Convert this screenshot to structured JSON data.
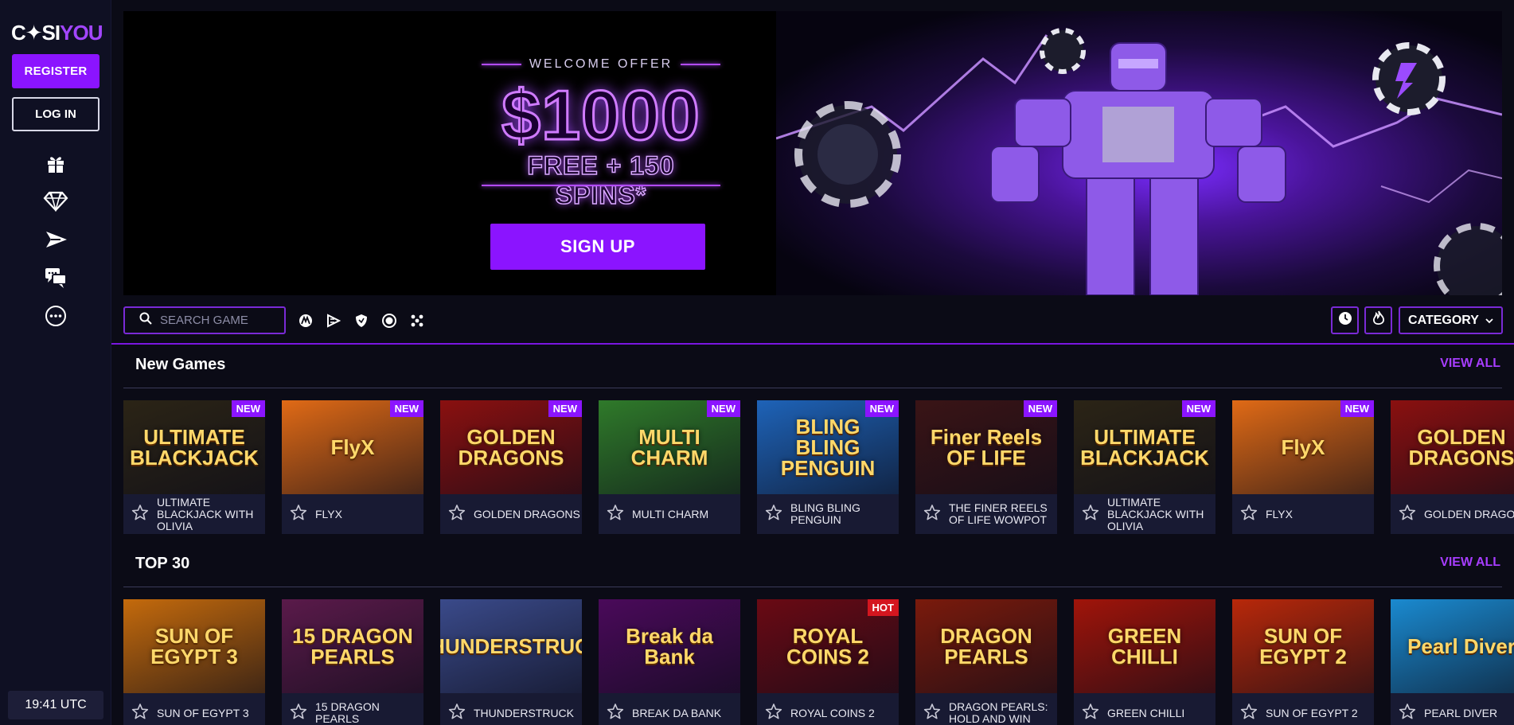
{
  "sidebar": {
    "logo_left": "C✦SI",
    "logo_right": "YOU",
    "register_label": "REGISTER",
    "login_label": "LOG IN",
    "icons": [
      "gift-icon",
      "diamond-icon",
      "sports-icon",
      "chat-icon",
      "more-icon"
    ],
    "clock": "19:41 UTC"
  },
  "banner": {
    "welcome": "WELCOME OFFER",
    "amount": "$1000",
    "sub": "FREE + 150 SPINS*",
    "signup_label": "SIGN UP"
  },
  "toolbar": {
    "search_placeholder": "SEARCH GAME",
    "category_label": "CATEGORY"
  },
  "sections": {
    "new_games": {
      "title": "New Games",
      "view_all": "VIEW ALL",
      "games": [
        {
          "name": "ULTIMATE BLACKJACK WITH OLIVIA",
          "thumb": "ULTIMATE BLACKJACK",
          "badge": "NEW",
          "bg": "#2b2416"
        },
        {
          "name": "FLYX",
          "thumb": "FlyX",
          "badge": "NEW",
          "bg": "#e06a16"
        },
        {
          "name": "GOLDEN DRAGONS",
          "thumb": "GOLDEN DRAGONS",
          "badge": "NEW",
          "bg": "#8a1010"
        },
        {
          "name": "MULTI CHARM",
          "thumb": "MULTI CHARM",
          "badge": "NEW",
          "bg": "#2f7a2a"
        },
        {
          "name": "BLING BLING PENGUIN",
          "thumb": "BLING BLING PENGUIN",
          "badge": "NEW",
          "bg": "#1e63b8"
        },
        {
          "name": "THE FINER REELS OF LIFE WOWPOT",
          "thumb": "Finer Reels OF LIFE",
          "badge": "NEW",
          "bg": "#3a1416"
        },
        {
          "name": "ULTIMATE BLACKJACK WITH OLIVIA",
          "thumb": "ULTIMATE BLACKJACK",
          "badge": "NEW",
          "bg": "#2b2416"
        },
        {
          "name": "FLYX",
          "thumb": "FlyX",
          "badge": "NEW",
          "bg": "#e06a16"
        },
        {
          "name": "GOLDEN DRAGONS",
          "thumb": "GOLDEN DRAGONS",
          "badge": "",
          "bg": "#8a1010"
        }
      ]
    },
    "top30": {
      "title": "TOP 30",
      "view_all": "VIEW ALL",
      "games": [
        {
          "name": "SUN OF EGYPT 3",
          "thumb": "SUN OF EGYPT 3",
          "badge": "",
          "bg": "#c46a0c"
        },
        {
          "name": "15 DRAGON PEARLS",
          "thumb": "15 DRAGON PEARLS",
          "badge": "",
          "bg": "#5a1a4a"
        },
        {
          "name": "THUNDERSTRUCK",
          "thumb": "THUNDERSTRUCK",
          "badge": "",
          "bg": "#3a4a8a"
        },
        {
          "name": "BREAK DA BANK",
          "thumb": "Break da Bank",
          "badge": "",
          "bg": "#4a0a5a"
        },
        {
          "name": "ROYAL COINS 2",
          "thumb": "ROYAL COINS 2",
          "badge": "HOT",
          "bg": "#6a0a14"
        },
        {
          "name": "DRAGON PEARLS: HOLD AND WIN",
          "thumb": "DRAGON PEARLS",
          "badge": "",
          "bg": "#7a1a0c"
        },
        {
          "name": "GREEN CHILLI",
          "thumb": "GREEN CHILLI",
          "badge": "",
          "bg": "#a0140a"
        },
        {
          "name": "SUN OF EGYPT 2",
          "thumb": "SUN OF EGYPT 2",
          "badge": "",
          "bg": "#b8280a"
        },
        {
          "name": "PEARL DIVER",
          "thumb": "Pearl Diver",
          "badge": "",
          "bg": "#1a8ad0"
        }
      ]
    }
  },
  "colors": {
    "accent": "#8b14ff",
    "badge_new": "#8b14ff",
    "badge_hot": "#d4161f"
  }
}
